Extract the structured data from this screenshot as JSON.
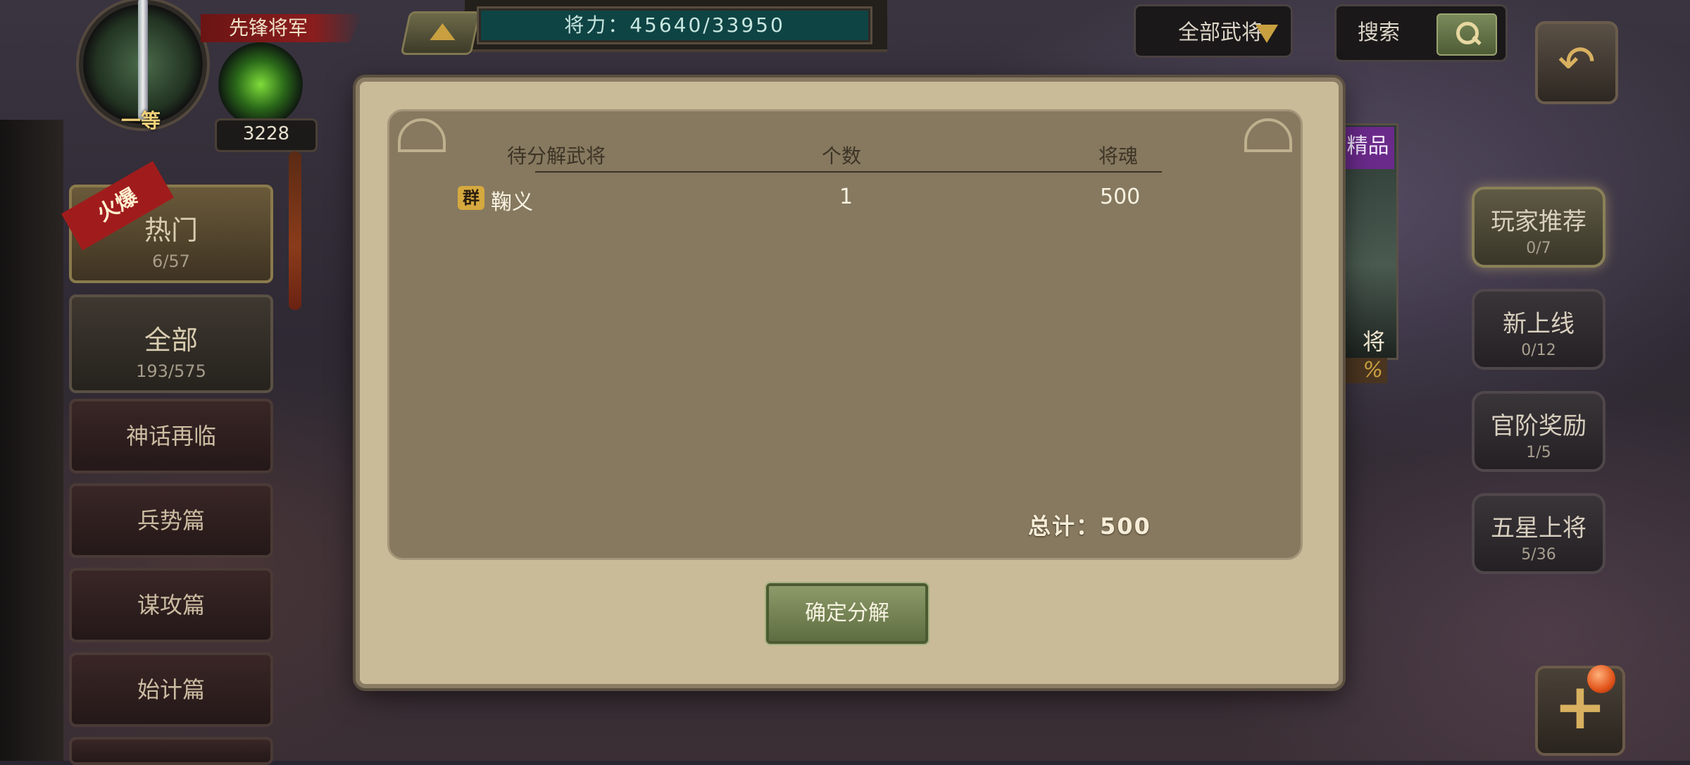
{
  "header": {
    "rank_grade": "一等",
    "rank_title": "先锋将军",
    "orb_value": "3228",
    "power_label": "将力：45640/33950"
  },
  "filter": {
    "selected": "全部武将"
  },
  "search": {
    "label": "搜索"
  },
  "categories": {
    "hot_tag": "火爆",
    "items": [
      {
        "title": "热门",
        "count": "6/57"
      },
      {
        "title": "全部",
        "count": "193/575"
      },
      {
        "title": "神话再临"
      },
      {
        "title": "兵势篇"
      },
      {
        "title": "谋攻篇"
      },
      {
        "title": "始计篇"
      }
    ]
  },
  "right_panel": {
    "card_tag": "精品",
    "card_label": "将",
    "card_pct": "%",
    "buttons": [
      {
        "title": "玩家推荐",
        "count": "0/7"
      },
      {
        "title": "新上线",
        "count": "0/12"
      },
      {
        "title": "官阶奖励",
        "count": "1/5"
      },
      {
        "title": "五星上将",
        "count": "5/36"
      }
    ]
  },
  "dialog": {
    "columns": [
      "待分解武将",
      "个数",
      "将魂"
    ],
    "rows": [
      {
        "faction": "群",
        "name": "鞠义",
        "count": "1",
        "soul": "500"
      }
    ],
    "total": "总计：500",
    "confirm": "确定分解"
  },
  "colors": {
    "accent_gold": "#c9a040",
    "dialog_bg": "#c9bb98",
    "table_bg": "#86795f",
    "confirm_green": "#7a8a5a"
  }
}
